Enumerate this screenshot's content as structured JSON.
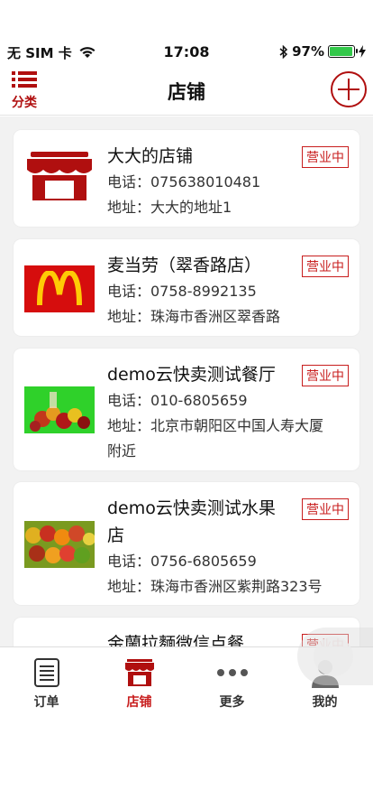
{
  "status_bar": {
    "carrier": "无 SIM 卡",
    "time": "17:08",
    "battery": "97%",
    "battery_level": 0.97,
    "battery_color": "#33c84a"
  },
  "navbar": {
    "title": "店铺",
    "category_label": "分类",
    "accent_color": "#b00f0f"
  },
  "stores": [
    {
      "name": "大大的店铺",
      "phone": "电话：075638010481",
      "address": "地址：大大的地址1",
      "status": "营业中",
      "thumb": "store-awning-icon"
    },
    {
      "name": "麦当劳（翠香路店）",
      "phone": "电话：0758-8992135",
      "address": "地址：珠海市香洲区翠香路",
      "status": "营业中",
      "thumb": "mcdonalds-logo"
    },
    {
      "name": "demo云快卖测试餐厅",
      "phone": "电话：010-6805659",
      "address": "地址：北京市朝阳区中国人寿大厦附近",
      "status": "营业中",
      "thumb": "fruit-photo"
    },
    {
      "name": "demo云快卖测试水果店",
      "phone": "电话：0756-6805659",
      "address": "地址：珠海市香洲区紫荆路323号",
      "status": "营业中",
      "thumb": "fruit-photo"
    },
    {
      "name": "金蘭拉麵微信点餐",
      "status": "营业中"
    }
  ],
  "tabbar": {
    "items": [
      {
        "label": "订单",
        "icon": "order-list-icon"
      },
      {
        "label": "店铺",
        "icon": "store-icon"
      },
      {
        "label": "更多",
        "icon": "more-dots-icon"
      },
      {
        "label": "我的",
        "icon": "profile-icon"
      }
    ],
    "active_color": "#c81e1e"
  }
}
